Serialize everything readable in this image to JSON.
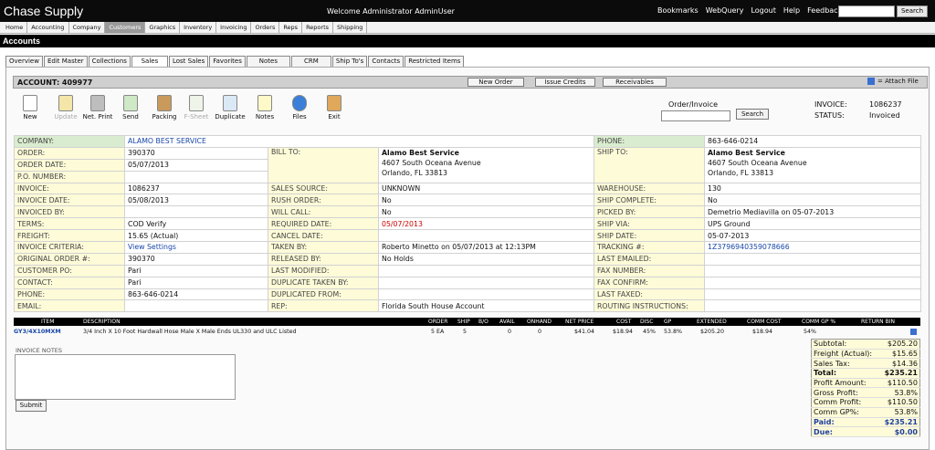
{
  "app": {
    "title": "Chase Supply",
    "welcome": "Welcome  Administrator AdminUser",
    "links": [
      "Bookmarks",
      "WebQuery",
      "Logout",
      "Help",
      "Feedback"
    ],
    "search_button": "Search"
  },
  "nav": [
    "Home",
    "Accounting",
    "Company",
    "Customers",
    "Graphics",
    "Inventory",
    "Invoicing",
    "Orders",
    "Reps",
    "Reports",
    "Shipping"
  ],
  "section": "Accounts",
  "tabs": [
    "Overview",
    "Edit Master",
    "Collections",
    "Sales",
    "Lost Sales",
    "Favorites",
    "Notes",
    "CRM",
    "Ship To's",
    "Contacts",
    "Restricted Items"
  ],
  "account": {
    "label": "ACCOUNT: 409977",
    "buttons": [
      "New Order",
      "Issue Credits",
      "Receivables"
    ],
    "attach": "= Attach File"
  },
  "toolbar": [
    "New",
    "Update",
    "Net. Print",
    "Send",
    "Packing",
    "F-Sheet",
    "Duplicate",
    "Notes",
    "Files",
    "Exit"
  ],
  "order_invoice": {
    "label": "Order/Invoice",
    "search": "Search",
    "invoice_label": "INVOICE:",
    "invoice": "1086237",
    "status_label": "STATUS:",
    "status": "Invoiced"
  },
  "company": {
    "l": "COMPANY:",
    "v": "ALAMO BEST SERVICE",
    "pl": "PHONE:",
    "pv": "863-646-0214"
  },
  "bill_to": {
    "name": "Alamo Best Service",
    "addr1": "4607 South Oceana Avenue",
    "addr2": "Orlando, FL 33813"
  },
  "ship_to": {
    "name": "Alamo Best Service",
    "addr1": "4607 South Oceana Avenue",
    "addr2": "Orlando, FL 33813"
  },
  "rows": [
    [
      "ORDER:",
      "390370",
      "BILL TO:",
      "",
      "SHIP TO:",
      ""
    ],
    [
      "ORDER DATE:",
      "05/07/2013",
      "",
      "",
      "",
      ""
    ],
    [
      "P.O. NUMBER:",
      "",
      "",
      "",
      "",
      ""
    ],
    [
      "INVOICE:",
      "1086237",
      "SALES SOURCE:",
      "UNKNOWN",
      "WAREHOUSE:",
      "130"
    ],
    [
      "INVOICE DATE:",
      "05/08/2013",
      "RUSH ORDER:",
      "No",
      "SHIP COMPLETE:",
      "No"
    ],
    [
      "INVOICED BY:",
      "",
      "WILL CALL:",
      "No",
      "PICKED BY:",
      "Demetrio Mediavilla on 05-07-2013"
    ],
    [
      "TERMS:",
      "COD Verify",
      "REQUIRED DATE:",
      "05/07/2013",
      "SHIP VIA:",
      "UPS Ground"
    ],
    [
      "FREIGHT:",
      "15.65 (Actual)",
      "CANCEL DATE:",
      "",
      "SHIP DATE:",
      "05-07-2013"
    ],
    [
      "INVOICE CRITERIA:",
      "View Settings",
      "TAKEN BY:",
      "Roberto Minetto on 05/07/2013 at 12:13PM",
      "TRACKING #:",
      "1Z3796940359078666"
    ],
    [
      "ORIGINAL ORDER #:",
      "390370",
      "RELEASED BY:",
      "No Holds",
      "LAST EMAILED:",
      ""
    ],
    [
      "CUSTOMER PO:",
      "Pari",
      "LAST MODIFIED:",
      "",
      "FAX NUMBER:",
      ""
    ],
    [
      "CONTACT:",
      "Pari",
      "DUPLICATE TAKEN BY:",
      "",
      "FAX CONFIRM:",
      ""
    ],
    [
      "PHONE:",
      "863-646-0214",
      "DUPLICATED FROM:",
      "",
      "LAST FAXED:",
      ""
    ],
    [
      "EMAIL:",
      "",
      "REP:",
      "Florida South House Account",
      "ROUTING INSTRUCTIONS:",
      ""
    ]
  ],
  "items_header": [
    "ITEM",
    "DESCRIPTION",
    "ORDER",
    "SHIP",
    "B/O",
    "AVAIL",
    "ONHAND",
    "NET PRICE",
    "COST",
    "DISC",
    "GP",
    "EXTENDED",
    "COMM COST",
    "COMM GP %",
    "RETURN BIN"
  ],
  "items": [
    [
      "GY3/4X10MXM",
      "3/4 Inch X 10 Foot Hardwall Hose Male X Male Ends UL330 and ULC Listed",
      "5 EA",
      "5",
      "0",
      "0",
      "0",
      "$41.04",
      "$18.94",
      "45%",
      "53.8%",
      "$205.20",
      "$18.94",
      "54%",
      ""
    ]
  ],
  "invoice_notes_label": "INVOICE NOTES",
  "submit": "Submit",
  "totals": [
    [
      "Subtotal:",
      "$205.20"
    ],
    [
      "Freight (Actual):",
      "$15.65"
    ],
    [
      "Sales Tax:",
      "$14.36"
    ],
    [
      "Total:",
      "$235.21"
    ],
    [
      "Profit Amount:",
      "$110.50"
    ],
    [
      "Gross Profit:",
      "53.8%"
    ],
    [
      "Comm Profit:",
      "$110.50"
    ],
    [
      "Comm GP%:",
      "53.8%"
    ],
    [
      "Paid:",
      "$235.21"
    ],
    [
      "Due:",
      "$0.00"
    ]
  ]
}
